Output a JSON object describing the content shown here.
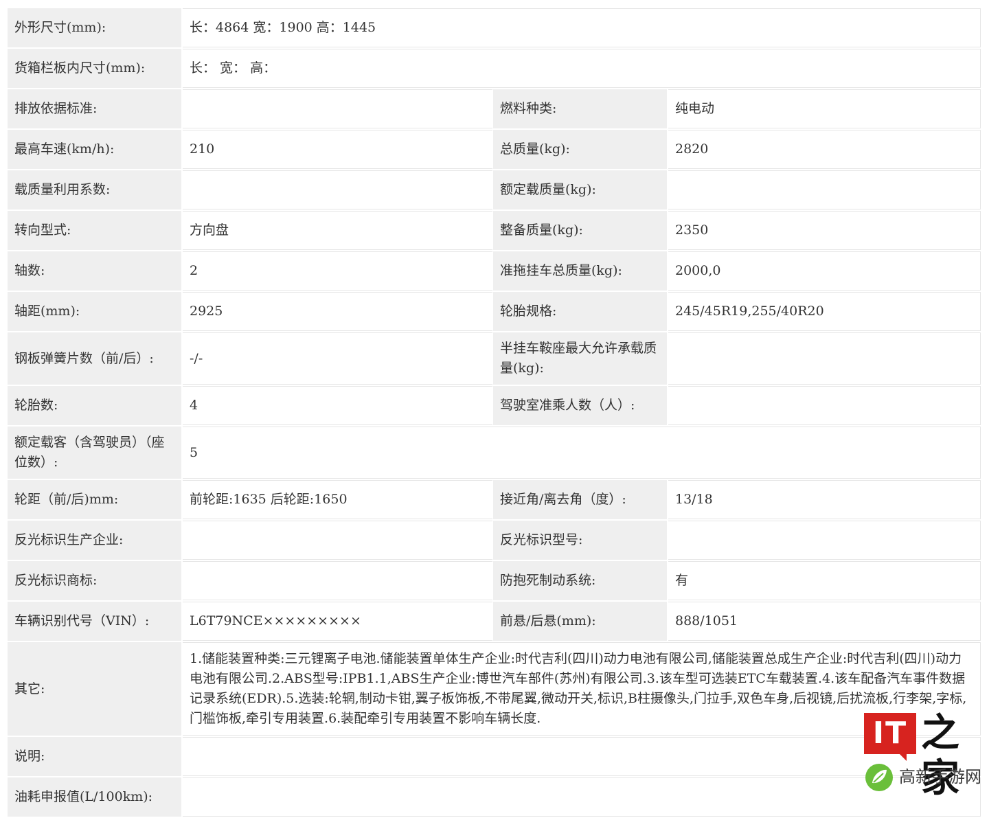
{
  "rows": [
    {
      "label": "外形尺寸(mm):",
      "value": "长：4864 宽：1900 高：1445"
    },
    {
      "label": "货箱栏板内尺寸(mm):",
      "value": "长：  宽：  高："
    },
    {
      "l1": "排放依据标准:",
      "v1": "",
      "l2": "燃料种类:",
      "v2": "纯电动"
    },
    {
      "l1": "最高车速(km/h):",
      "v1": "210",
      "l2": "总质量(kg):",
      "v2": "2820"
    },
    {
      "l1": "载质量利用系数:",
      "v1": "",
      "l2": "额定载质量(kg):",
      "v2": ""
    },
    {
      "l1": "转向型式:",
      "v1": "方向盘",
      "l2": "整备质量(kg):",
      "v2": "2350"
    },
    {
      "l1": "轴数:",
      "v1": "2",
      "l2": "准拖挂车总质量(kg):",
      "v2": "2000,0"
    },
    {
      "l1": "轴距(mm):",
      "v1": "2925",
      "l2": "轮胎规格:",
      "v2": "245/45R19,255/40R20"
    },
    {
      "l1": "钢板弹簧片数（前/后）:",
      "v1": "-/-",
      "l2": "半挂车鞍座最大允许承载质量(kg):",
      "v2": ""
    },
    {
      "l1": "轮胎数:",
      "v1": "4",
      "l2": "驾驶室准乘人数（人）:",
      "v2": ""
    },
    {
      "label": "额定载客（含驾驶员）（座位数）:",
      "value": "5"
    },
    {
      "l1": "轮距（前/后)mm:",
      "v1": "前轮距:1635 后轮距:1650",
      "l2": "接近角/离去角（度）:",
      "v2": "13/18"
    },
    {
      "l1": "反光标识生产企业:",
      "v1": "",
      "l2": "反光标识型号:",
      "v2": ""
    },
    {
      "l1": "反光标识商标:",
      "v1": "",
      "l2": "防抱死制动系统:",
      "v2": "有"
    },
    {
      "l1": "车辆识别代号（VIN）:",
      "v1": "L6T79NCE×××××××××",
      "l2": "前悬/后悬(mm):",
      "v2": "888/1051"
    },
    {
      "label": "其它:",
      "value": "1.储能装置种类:三元锂离子电池.储能装置单体生产企业:时代吉利(四川)动力电池有限公司,储能装置总成生产企业:时代吉利(四川)动力电池有限公司.2.ABS型号:IPB1.1,ABS生产企业:博世汽车部件(苏州)有限公司.3.该车型可选装ETC车载装置.4.该车配备汽车事件数据记录系统(EDR).5.选装:轮辋,制动卡钳,翼子板饰板,不带尾翼,微动开关,标识,B柱摄像头,门拉手,双色车身,后视镜,后扰流板,行李架,字标,门槛饰板,牵引专用装置.6.装配牵引专用装置不影响车辆长度."
    },
    {
      "label": "说明:",
      "value": ""
    },
    {
      "label": "油耗申报值(L/100km):",
      "value": ""
    }
  ],
  "watermark": {
    "logo_text": "IT",
    "logo_suffix": "之家",
    "site_name": "高新手游网",
    "brand_red": "#d7231f",
    "icon_green": "#6abf3a"
  }
}
